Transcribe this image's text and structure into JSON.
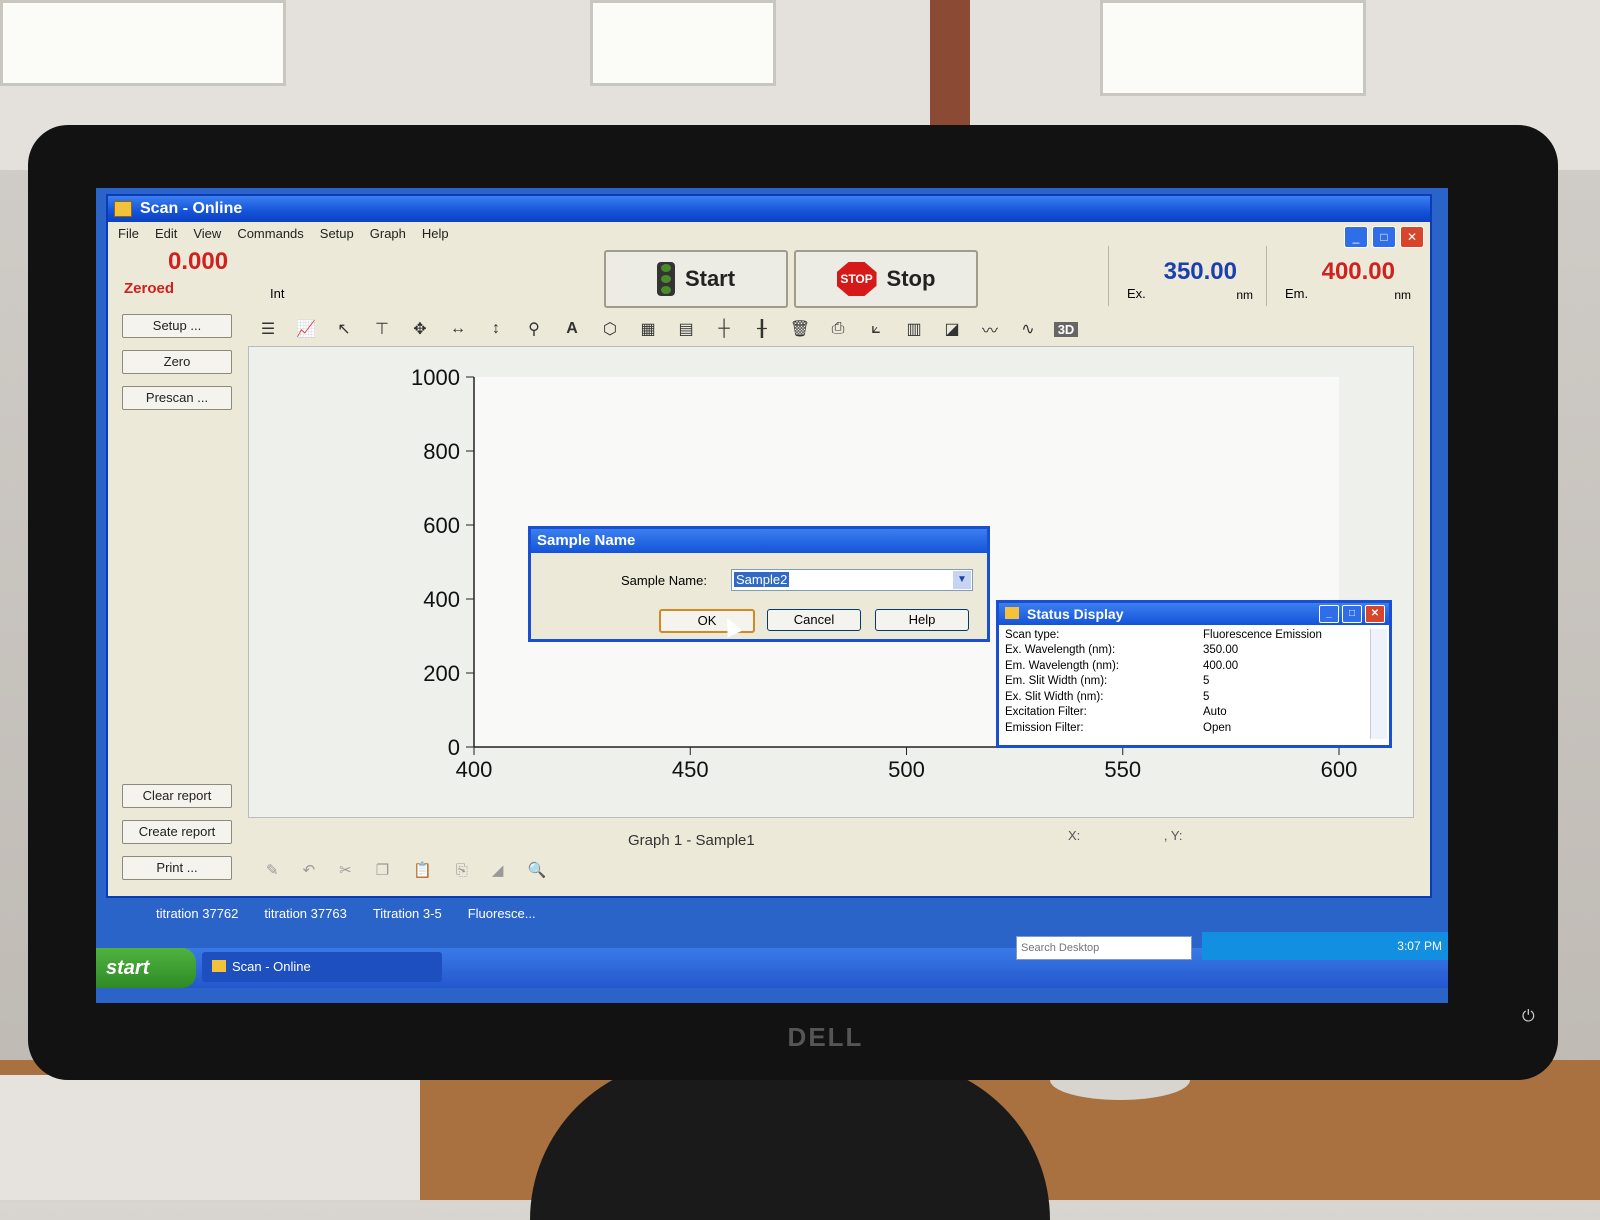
{
  "window": {
    "title": "Scan - Online"
  },
  "menu": [
    "File",
    "Edit",
    "View",
    "Commands",
    "Setup",
    "Graph",
    "Help"
  ],
  "readout": {
    "value": "0.000",
    "status": "Zeroed",
    "mode": "Int"
  },
  "controls": {
    "start_label": "Start",
    "stop_label": "Stop",
    "stop_sign_text": "STOP"
  },
  "wavelength": {
    "ex": {
      "value": "350.00",
      "label": "Ex.",
      "unit": "nm",
      "color": "#1a3fb0"
    },
    "em": {
      "value": "400.00",
      "label": "Em.",
      "unit": "nm",
      "color": "#d02020"
    }
  },
  "left_buttons": {
    "setup": "Setup ...",
    "zero": "Zero",
    "prescan": "Prescan ..."
  },
  "lower_buttons": {
    "clear": "Clear report",
    "create": "Create report",
    "print": "Print ..."
  },
  "toolbar_icons": [
    "list-icon",
    "graph-icon",
    "pointer-icon",
    "cursor-tool-icon",
    "move-icon",
    "h-resize-icon",
    "v-resize-icon",
    "zoom-icon",
    "text-icon",
    "shape-icon",
    "graph-a-icon",
    "graph-b-icon",
    "axis-icon",
    "axis-b-icon",
    "trash-icon",
    "print-graph-icon",
    "axes-icon",
    "table-icon",
    "chart-icon",
    "overlay-icon",
    "overlay-b-icon",
    "3d-icon"
  ],
  "toolbar_3d_label": "3D",
  "chart_data": {
    "type": "line",
    "x": [],
    "series": [],
    "xlim": [
      400,
      600
    ],
    "ylim": [
      0,
      1000
    ],
    "xticks": [
      400,
      450,
      500,
      550,
      600
    ],
    "yticks": [
      0,
      200,
      400,
      600,
      800,
      1000
    ],
    "title": "Graph 1 - Sample1",
    "grid": false
  },
  "graph": {
    "caption": "Graph 1 - Sample1",
    "x_label": "X:",
    "y_label": ", Y:"
  },
  "dialog": {
    "title": "Sample Name",
    "field_label": "Sample Name:",
    "field_value": "Sample2",
    "ok": "OK",
    "cancel": "Cancel",
    "help": "Help"
  },
  "status_display": {
    "title": "Status Display",
    "rows": [
      {
        "k": "Scan type:",
        "v": "Fluorescence Emission"
      },
      {
        "k": "Ex. Wavelength (nm):",
        "v": "350.00"
      },
      {
        "k": "Em. Wavelength (nm):",
        "v": "400.00"
      },
      {
        "k": "Em. Slit Width (nm):",
        "v": "5"
      },
      {
        "k": "Ex. Slit Width (nm):",
        "v": "5"
      },
      {
        "k": "Excitation Filter:",
        "v": "Auto"
      },
      {
        "k": "Emission Filter:",
        "v": "Open"
      }
    ]
  },
  "desktop_labels": [
    "titration 37762",
    "titration 37763",
    "Titration 3-5",
    "Fluoresce..."
  ],
  "taskbar": {
    "start": "start",
    "task": "Scan - Online",
    "search_placeholder": "Search Desktop",
    "clock": "3:07 PM"
  },
  "monitor_brand": "DELL"
}
